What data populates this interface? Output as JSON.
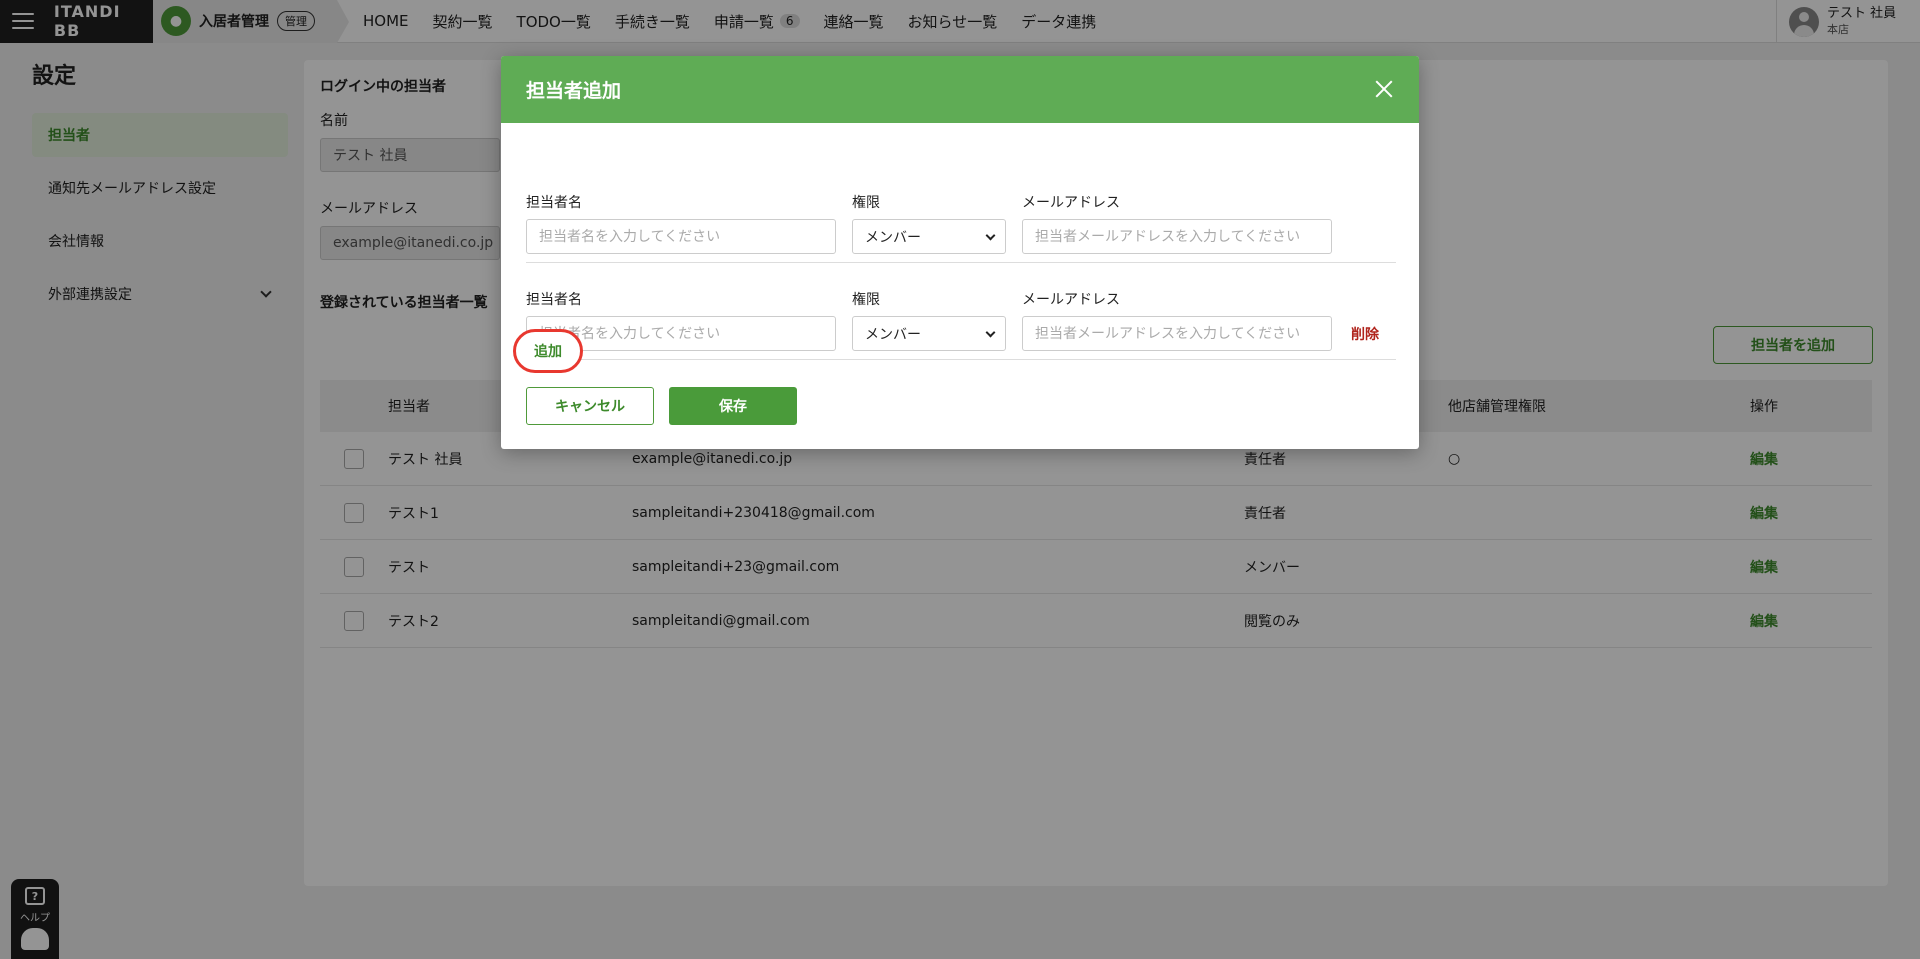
{
  "topbar": {
    "logo": "ITANDI BB",
    "product_name": "入居者管理",
    "product_badge": "管理",
    "nav": [
      {
        "label": "HOME"
      },
      {
        "label": "契約一覧"
      },
      {
        "label": "TODO一覧"
      },
      {
        "label": "手続き一覧"
      },
      {
        "label": "申請一覧",
        "count": "6"
      },
      {
        "label": "連絡一覧"
      },
      {
        "label": "お知らせ一覧"
      },
      {
        "label": "データ連携"
      }
    ],
    "user_name": "テスト 社員",
    "user_store": "本店"
  },
  "page_title": "設定",
  "sidebar": {
    "items": [
      {
        "label": "担当者"
      },
      {
        "label": "通知先メールアドレス設定"
      },
      {
        "label": "会社情報"
      },
      {
        "label": "外部連携設定"
      }
    ]
  },
  "main": {
    "login_title": "ログイン中の担当者",
    "name_label": "名前",
    "name_value": "テスト 社員",
    "email_label": "メールアドレス",
    "email_value": "example@itanedi.co.jp",
    "list_title": "登録されている担当者一覧",
    "add_staff_button": "担当者を追加",
    "table": {
      "headers": {
        "name": "担当者",
        "other": "他店舗管理権限",
        "op": "操作"
      },
      "rows": [
        {
          "name": "テスト 社員",
          "email": "example@itanedi.co.jp",
          "role": "責任者",
          "other": "○",
          "op": "編集"
        },
        {
          "name": "テスト1",
          "email": "sampleitandi+230418@gmail.com",
          "role": "責任者",
          "other": "",
          "op": "編集"
        },
        {
          "name": "テスト",
          "email": "sampleitandi+23@gmail.com",
          "role": "メンバー",
          "other": "",
          "op": "編集"
        },
        {
          "name": "テスト2",
          "email": "sampleitandi@gmail.com",
          "role": "閲覧のみ",
          "other": "",
          "op": "編集"
        }
      ]
    }
  },
  "modal": {
    "title": "担当者追加",
    "entries": [
      {
        "name_label": "担当者名",
        "name_placeholder": "担当者名を入力してください",
        "role_label": "権限",
        "role_value": "メンバー",
        "email_label": "メールアドレス",
        "email_placeholder": "担当者メールアドレスを入力してください"
      },
      {
        "name_label": "担当者名",
        "name_placeholder": "担当者名を入力してください",
        "role_label": "権限",
        "role_value": "メンバー",
        "email_label": "メールアドレス",
        "email_placeholder": "担当者メールアドレスを入力してください",
        "delete_label": "削除"
      }
    ],
    "add_label": "追加",
    "cancel_label": "キャンセル",
    "save_label": "保存"
  },
  "help": {
    "label": "ヘルプ"
  }
}
